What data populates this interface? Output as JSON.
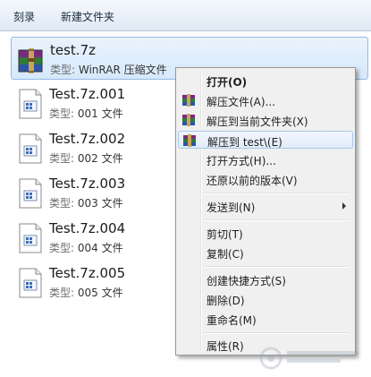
{
  "toolbar": {
    "burn_label": "刻录",
    "new_folder_label": "新建文件夹"
  },
  "files": [
    {
      "name": "test.7z",
      "type_label": "类型:",
      "type_value": "WinRAR 压缩文件",
      "icon": "winrar-archive-icon"
    },
    {
      "name": "Test.7z.001",
      "type_label": "类型:",
      "type_value": "001 文件",
      "icon": "generic-file-icon"
    },
    {
      "name": "Test.7z.002",
      "type_label": "类型:",
      "type_value": "002 文件",
      "icon": "generic-file-icon"
    },
    {
      "name": "Test.7z.003",
      "type_label": "类型:",
      "type_value": "003 文件",
      "icon": "generic-file-icon"
    },
    {
      "name": "Test.7z.004",
      "type_label": "类型:",
      "type_value": "004 文件",
      "icon": "generic-file-icon"
    },
    {
      "name": "Test.7z.005",
      "type_label": "类型:",
      "type_value": "005 文件",
      "icon": "generic-file-icon"
    }
  ],
  "context_menu": {
    "open": "打开(O)",
    "extract_files": "解压文件(A)...",
    "extract_here": "解压到当前文件夹(X)",
    "extract_to": "解压到 test\\(E)",
    "open_with": "打开方式(H)...",
    "restore_previous": "还原以前的版本(V)",
    "send_to": "发送到(N)",
    "cut": "剪切(T)",
    "copy": "复制(C)",
    "create_shortcut": "创建快捷方式(S)",
    "delete": "删除(D)",
    "rename": "重命名(M)",
    "properties": "属性(R)"
  },
  "colors": {
    "selection_border": "#93b9e6",
    "menu_background": "#f0f0f0",
    "toolbar_top": "#f5f9fd",
    "toolbar_bottom": "#dfe9f5"
  }
}
